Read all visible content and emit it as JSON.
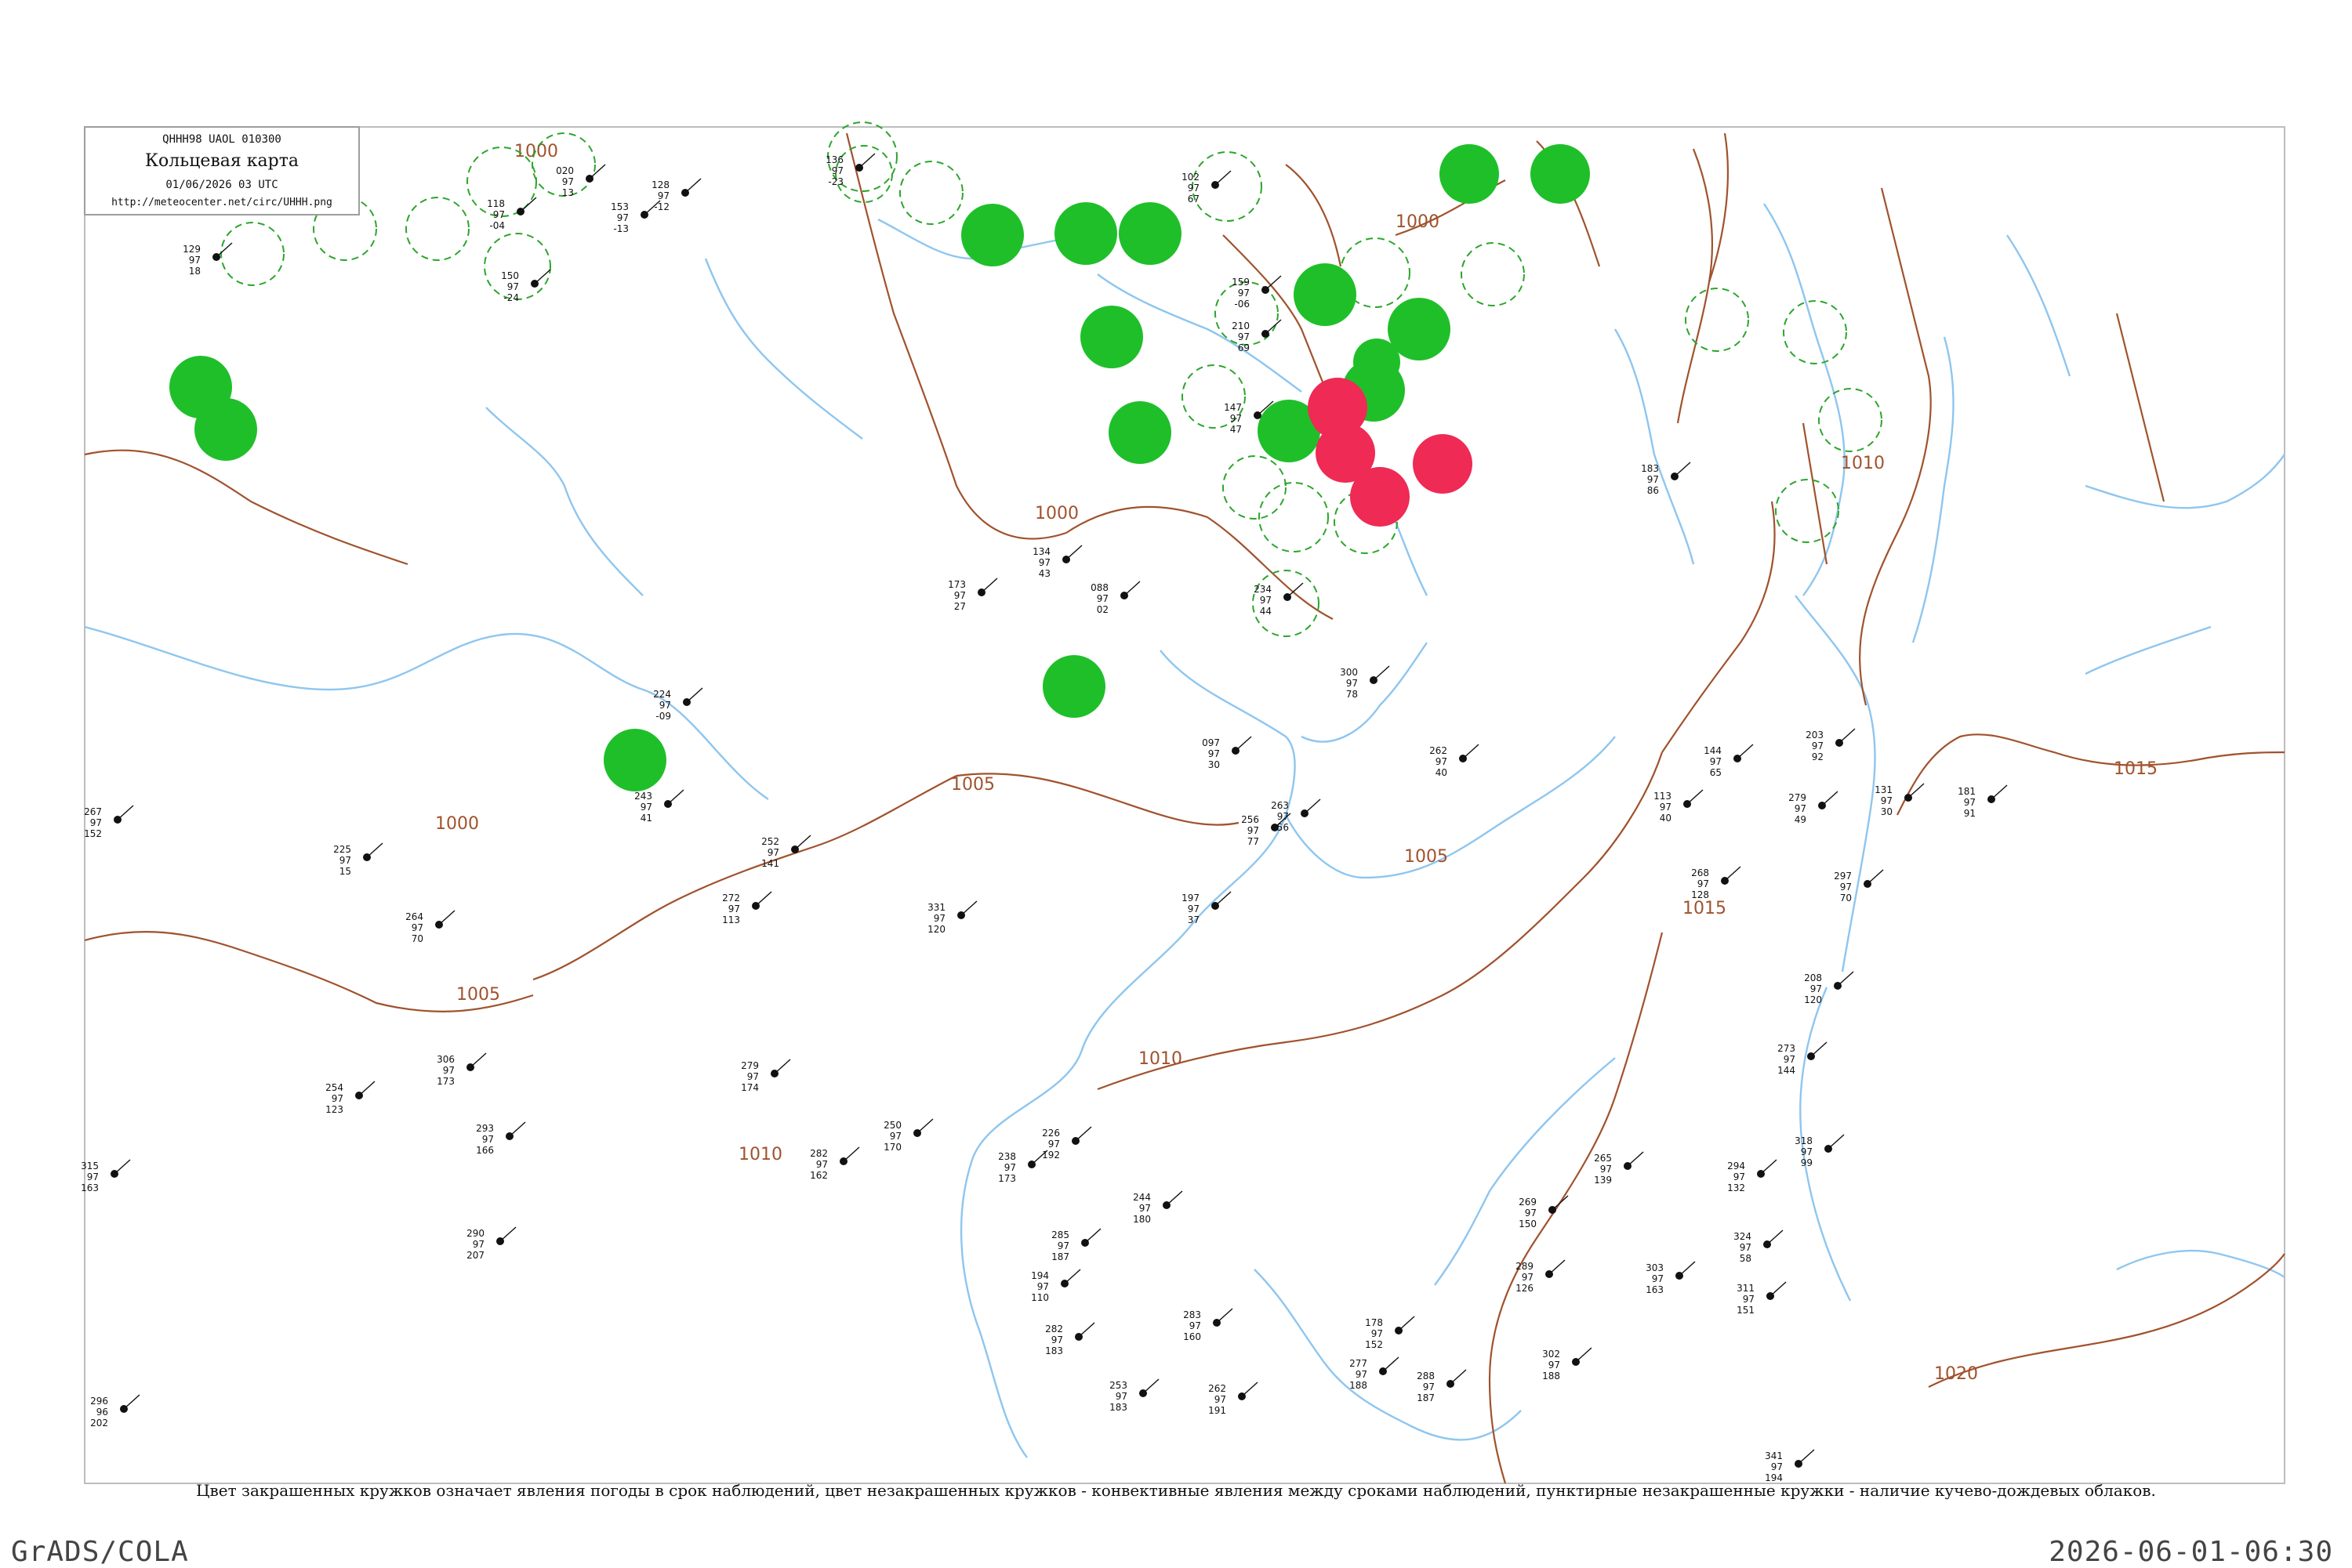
{
  "header": {
    "code": "QHHH98  UAOL  010300",
    "title": "Кольцевая карта",
    "date": "01/06/2026 03 UTC",
    "url": "http://meteocenter.net/circ/UHHH.png"
  },
  "caption": "Цвет закрашенных кружков означает явления погоды в срок наблюдений, цвет незакрашенных кружков - конвективные явления между сроками наблюдений, пунктирные незакрашенные кружки - наличие кучево-дождевых облаков.",
  "footer": {
    "left": "GrADS/COLA",
    "right": "2026-06-01-06:30"
  },
  "colors": {
    "coast": "#8ec6ef",
    "isobar": "#a0522d",
    "green_fill": "#1fbf2a",
    "red_fill": "#ee2a55",
    "ring": "#2ca52c",
    "station": "#111111"
  },
  "isobars": [
    {
      "label": "1000"
    },
    {
      "label": "1005"
    },
    {
      "label": "1010"
    },
    {
      "label": "1015"
    },
    {
      "label": "1020"
    }
  ],
  "stations": [
    {
      "v1": "118",
      "v2": "97",
      "v3": "-04"
    },
    {
      "v1": "150",
      "v2": "97",
      "v3": "-24"
    },
    {
      "v1": "020",
      "v2": "97",
      "v3": "13"
    },
    {
      "v1": "153",
      "v2": "97",
      "v3": "-13"
    },
    {
      "v1": "128",
      "v2": "97",
      "v3": "-12"
    },
    {
      "v1": "136",
      "v2": "97",
      "v3": "-23"
    },
    {
      "v1": "129",
      "v2": "97",
      "v3": "18"
    },
    {
      "v1": "102",
      "v2": "97",
      "v3": "67"
    },
    {
      "v1": "159",
      "v2": "97",
      "v3": "-06"
    },
    {
      "v1": "210",
      "v2": "97",
      "v3": "69"
    },
    {
      "v1": "147",
      "v2": "97",
      "v3": "47"
    },
    {
      "v1": "173",
      "v2": "97",
      "v3": "27"
    },
    {
      "v1": "134",
      "v2": "97",
      "v3": "43"
    },
    {
      "v1": "234",
      "v2": "97",
      "v3": "44"
    },
    {
      "v1": "088",
      "v2": "97",
      "v3": "02"
    },
    {
      "v1": "097",
      "v2": "97",
      "v3": "30"
    },
    {
      "v1": "183",
      "v2": "97",
      "v3": "86"
    },
    {
      "v1": "300",
      "v2": "97",
      "v3": "78"
    },
    {
      "v1": "224",
      "v2": "97",
      "v3": "-09"
    },
    {
      "v1": "243",
      "v2": "97",
      "v3": "41"
    },
    {
      "v1": "252",
      "v2": "97",
      "v3": "141"
    },
    {
      "v1": "225",
      "v2": "97",
      "v3": "15"
    },
    {
      "v1": "264",
      "v2": "97",
      "v3": "70"
    },
    {
      "v1": "272",
      "v2": "97",
      "v3": "113"
    },
    {
      "v1": "331",
      "v2": "97",
      "v3": "120"
    },
    {
      "v1": "254",
      "v2": "97",
      "v3": "123"
    },
    {
      "v1": "279",
      "v2": "97",
      "v3": "174"
    },
    {
      "v1": "315",
      "v2": "97",
      "v3": "163"
    },
    {
      "v1": "290",
      "v2": "97",
      "v3": "207"
    },
    {
      "v1": "296",
      "v2": "96",
      "v3": "202"
    },
    {
      "v1": "282",
      "v2": "97",
      "v3": "162"
    },
    {
      "v1": "306",
      "v2": "97",
      "v3": "173"
    },
    {
      "v1": "293",
      "v2": "97",
      "v3": "166"
    },
    {
      "v1": "267",
      "v2": "97",
      "v3": "152"
    },
    {
      "v1": "238",
      "v2": "97",
      "v3": "173"
    },
    {
      "v1": "256",
      "v2": "97",
      "v3": "77"
    },
    {
      "v1": "197",
      "v2": "97",
      "v3": "37"
    },
    {
      "v1": "263",
      "v2": "97",
      "v3": "56"
    },
    {
      "v1": "262",
      "v2": "97",
      "v3": "40"
    },
    {
      "v1": "113",
      "v2": "97",
      "v3": "40"
    },
    {
      "v1": "144",
      "v2": "97",
      "v3": "65"
    },
    {
      "v1": "279",
      "v2": "97",
      "v3": "49"
    },
    {
      "v1": "268",
      "v2": "97",
      "v3": "128"
    },
    {
      "v1": "297",
      "v2": "97",
      "v3": "70"
    },
    {
      "v1": "131",
      "v2": "97",
      "v3": "30"
    },
    {
      "v1": "181",
      "v2": "97",
      "v3": "91"
    },
    {
      "v1": "203",
      "v2": "97",
      "v3": "92"
    },
    {
      "v1": "208",
      "v2": "97",
      "v3": "120"
    },
    {
      "v1": "273",
      "v2": "97",
      "v3": "144"
    },
    {
      "v1": "318",
      "v2": "97",
      "v3": "99"
    },
    {
      "v1": "294",
      "v2": "97",
      "v3": "132"
    },
    {
      "v1": "324",
      "v2": "97",
      "v3": "58"
    },
    {
      "v1": "311",
      "v2": "97",
      "v3": "151"
    },
    {
      "v1": "265",
      "v2": "97",
      "v3": "139"
    },
    {
      "v1": "269",
      "v2": "97",
      "v3": "150"
    },
    {
      "v1": "289",
      "v2": "97",
      "v3": "126"
    },
    {
      "v1": "303",
      "v2": "97",
      "v3": "163"
    },
    {
      "v1": "302",
      "v2": "97",
      "v3": "188"
    },
    {
      "v1": "341",
      "v2": "97",
      "v3": "194"
    },
    {
      "v1": "244",
      "v2": "97",
      "v3": "180"
    },
    {
      "v1": "283",
      "v2": "97",
      "v3": "160"
    },
    {
      "v1": "250",
      "v2": "97",
      "v3": "170"
    },
    {
      "v1": "226",
      "v2": "97",
      "v3": "192"
    },
    {
      "v1": "285",
      "v2": "97",
      "v3": "187"
    },
    {
      "v1": "194",
      "v2": "97",
      "v3": "110"
    },
    {
      "v1": "282",
      "v2": "97",
      "v3": "183"
    },
    {
      "v1": "253",
      "v2": "97",
      "v3": "183"
    },
    {
      "v1": "262",
      "v2": "97",
      "v3": "191"
    },
    {
      "v1": "277",
      "v2": "97",
      "v3": "188"
    },
    {
      "v1": "288",
      "v2": "97",
      "v3": "187"
    },
    {
      "v1": "178",
      "v2": "97",
      "v3": "152"
    }
  ],
  "weather_circles": [
    {
      "kind": "green"
    },
    {
      "kind": "green"
    },
    {
      "kind": "green"
    },
    {
      "kind": "green"
    },
    {
      "kind": "green"
    },
    {
      "kind": "green"
    },
    {
      "kind": "green"
    },
    {
      "kind": "green"
    },
    {
      "kind": "green"
    },
    {
      "kind": "green"
    },
    {
      "kind": "green"
    },
    {
      "kind": "green"
    },
    {
      "kind": "green"
    },
    {
      "kind": "green"
    },
    {
      "kind": "green"
    },
    {
      "kind": "green"
    },
    {
      "kind": "green"
    },
    {
      "kind": "green"
    },
    {
      "kind": "red"
    },
    {
      "kind": "red"
    },
    {
      "kind": "red"
    },
    {
      "kind": "red"
    },
    {
      "kind": "red"
    }
  ],
  "rings": [
    {
      "n": 1
    },
    {
      "n": 2
    },
    {
      "n": 3
    },
    {
      "n": 4
    },
    {
      "n": 5
    },
    {
      "n": 6
    },
    {
      "n": 7
    },
    {
      "n": 8
    },
    {
      "n": 9
    },
    {
      "n": 10
    },
    {
      "n": 11
    },
    {
      "n": 12
    },
    {
      "n": 13
    },
    {
      "n": 14
    },
    {
      "n": 15
    },
    {
      "n": 16
    },
    {
      "n": 17
    },
    {
      "n": 18
    },
    {
      "n": 19
    },
    {
      "n": 20
    },
    {
      "n": 21
    },
    {
      "n": 22
    }
  ]
}
